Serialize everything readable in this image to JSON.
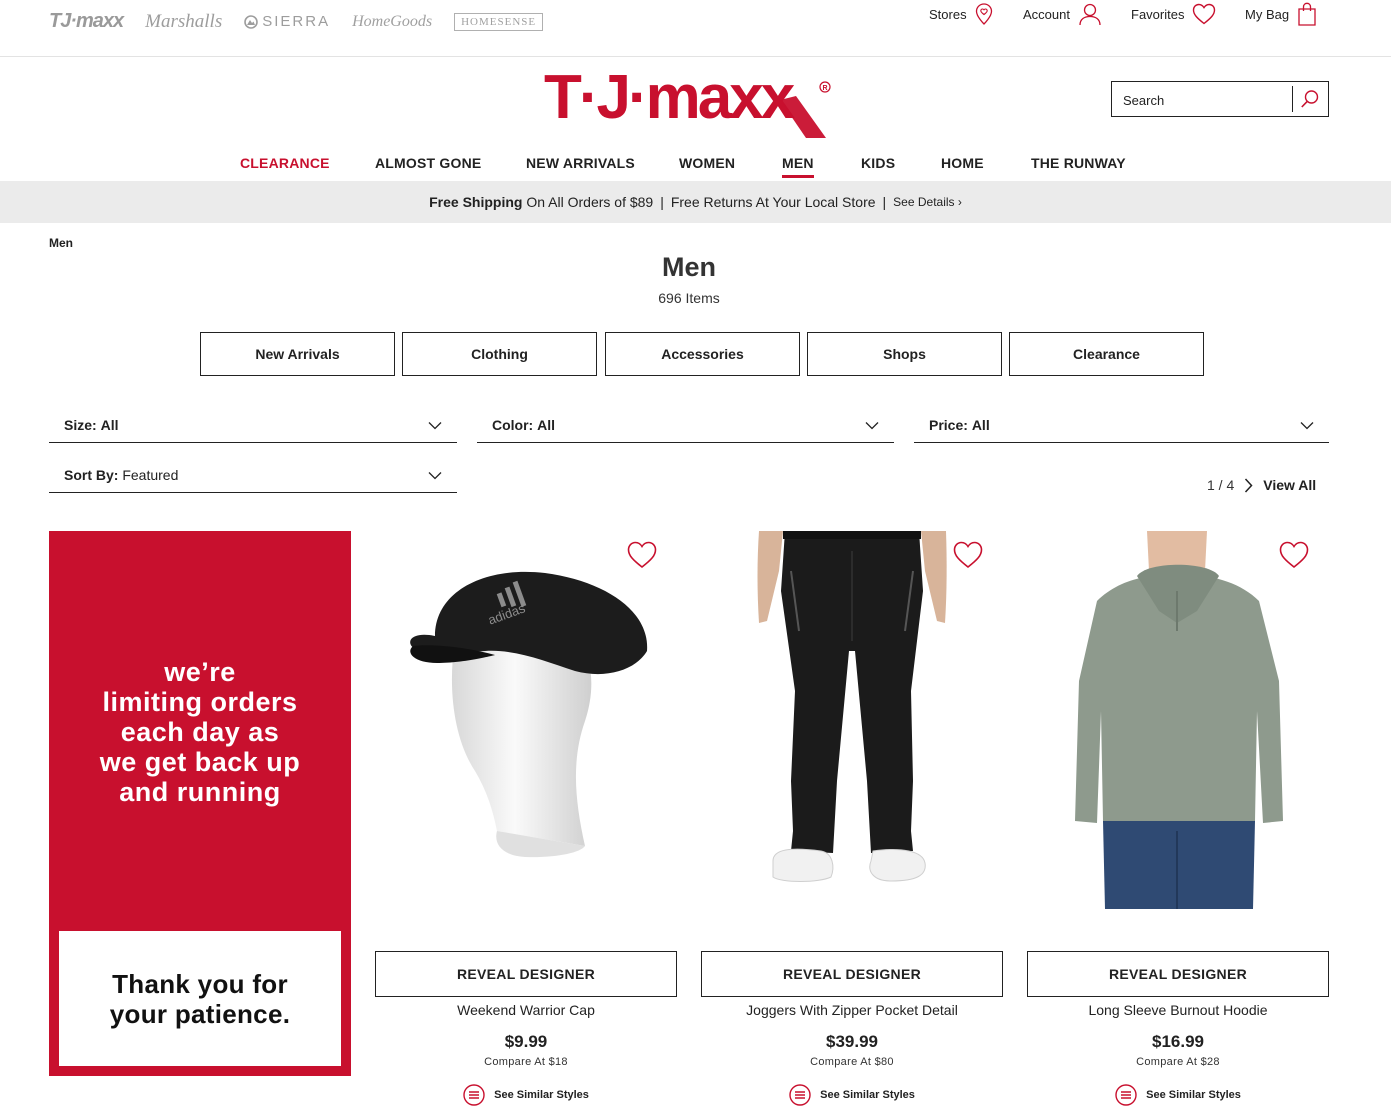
{
  "brands": [
    "TJ·maxx",
    "Marshalls",
    "SIERRA",
    "HomeGoods",
    "HOMESENSE"
  ],
  "utilities": {
    "stores": "Stores",
    "account": "Account",
    "favorites": "Favorites",
    "bag": "My Bag"
  },
  "logo": "T·J·maxx",
  "search": {
    "placeholder": "Search"
  },
  "nav": [
    "CLEARANCE",
    "ALMOST GONE",
    "NEW ARRIVALS",
    "WOMEN",
    "MEN",
    "KIDS",
    "HOME",
    "THE RUNWAY"
  ],
  "promo": {
    "bold": "Free Shipping",
    "text1": "On All Orders of $89",
    "sep": "|",
    "text2": "Free Returns At Your Local Store",
    "details": "See Details ›"
  },
  "breadcrumb": "Men",
  "page": {
    "title": "Men",
    "count": "696 Items"
  },
  "categories": [
    "New Arrivals",
    "Clothing",
    "Accessories",
    "Shops",
    "Clearance"
  ],
  "filters": {
    "size": {
      "label": "Size:",
      "value": "All"
    },
    "color": {
      "label": "Color:",
      "value": "All"
    },
    "price": {
      "label": "Price:",
      "value": "All"
    },
    "sort": {
      "label": "Sort By:",
      "value": "Featured"
    }
  },
  "pagination": {
    "text": "1 / 4",
    "view_all": "View All"
  },
  "notice": {
    "lines": [
      "we’re",
      "limiting orders",
      "each day as",
      "we get back up",
      "and running"
    ],
    "thanks_lines": [
      "Thank you for",
      "your patience."
    ]
  },
  "products": [
    {
      "reveal": "REVEAL DESIGNER",
      "name": "Weekend Warrior Cap",
      "price": "$9.99",
      "compare": "Compare At  $18",
      "similar": "See Similar Styles"
    },
    {
      "reveal": "REVEAL DESIGNER",
      "name": "Joggers With Zipper Pocket Detail",
      "price": "$39.99",
      "compare": "Compare At  $80",
      "similar": "See Similar Styles"
    },
    {
      "reveal": "REVEAL DESIGNER",
      "name": "Long Sleeve Burnout Hoodie",
      "price": "$16.99",
      "compare": "Compare At  $28",
      "similar": "See Similar Styles"
    }
  ],
  "colors": {
    "brand_red": "#c8102e",
    "promo_bg": "#ebebeb",
    "text": "#222222"
  }
}
